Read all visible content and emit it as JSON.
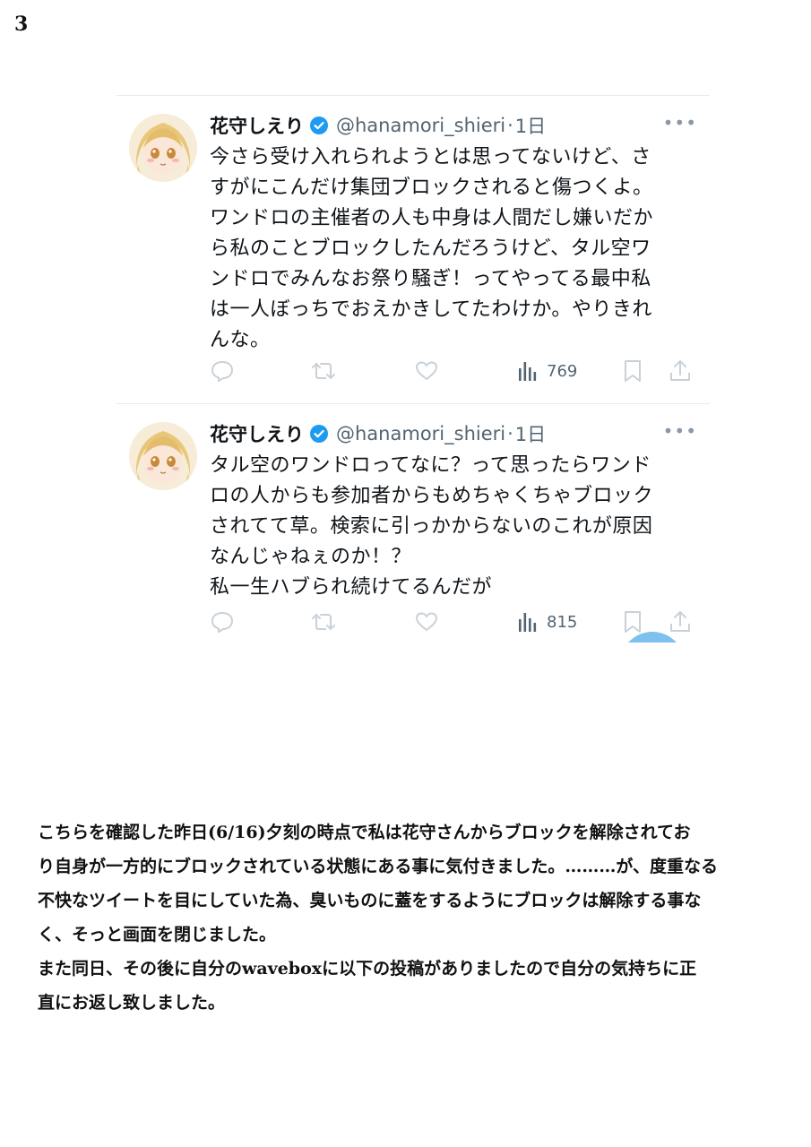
{
  "page": {
    "number": "3"
  },
  "tweets": [
    {
      "display_name": "花守しえり",
      "handle": "@hanamori_shieri",
      "separator": "·",
      "time": "1日",
      "more": "•••",
      "text": "今さら受け入れられようとは思ってないけど、さ\nすがにこんだけ集団ブロックされると傷つくよ。\nワンドロの主催者の人も中身は人間だし嫌いだか\nら私のことブロックしたんだろうけど、タル空ワ\nンドロでみんなお祭り騒ぎ！ってやってる最中私\nは一人ぼっちでおえかきしてたわけか。やりきれ\nんな。",
      "views": "769",
      "verified_color": "#1d9bf0",
      "icons": [
        "reply-icon",
        "retweet-icon",
        "like-icon",
        "views-icon",
        "bookmark-icon",
        "share-icon"
      ]
    },
    {
      "display_name": "花守しえり",
      "handle": "@hanamori_shieri",
      "separator": "·",
      "time": "1日",
      "more": "•••",
      "text": "タル空のワンドロってなに？って思ったらワンド\nロの人からも参加者からもめちゃくちゃブロック\nされてて草。検索に引っかからないのこれが原因\nなんじゃねぇのか！？\n私一生ハブられ続けてるんだが",
      "views": "815",
      "verified_color": "#1d9bf0",
      "icons": [
        "reply-icon",
        "retweet-icon",
        "like-icon",
        "views-icon",
        "bookmark-icon",
        "share-icon"
      ]
    }
  ],
  "caption": "こちらを確認した昨日(6/16)夕刻の時点で私は花守さんからブロックを解除されてお\nり自身が一方的にブロックされている状態にある事に気付きました。………が、度重なる\n不快なツイートを目にしていた為、臭いものに蓋をするようにブロックは解除する事な\nく、そっと画面を閉じました。\nまた同日、その後に自分のwaveboxに以下の投稿がありましたので自分の気持ちに正\n直にお返し致しました。",
  "colors": {
    "accent": "#1d9bf0",
    "icon_gray": "#c9d1d8",
    "text_gray": "#536471"
  }
}
